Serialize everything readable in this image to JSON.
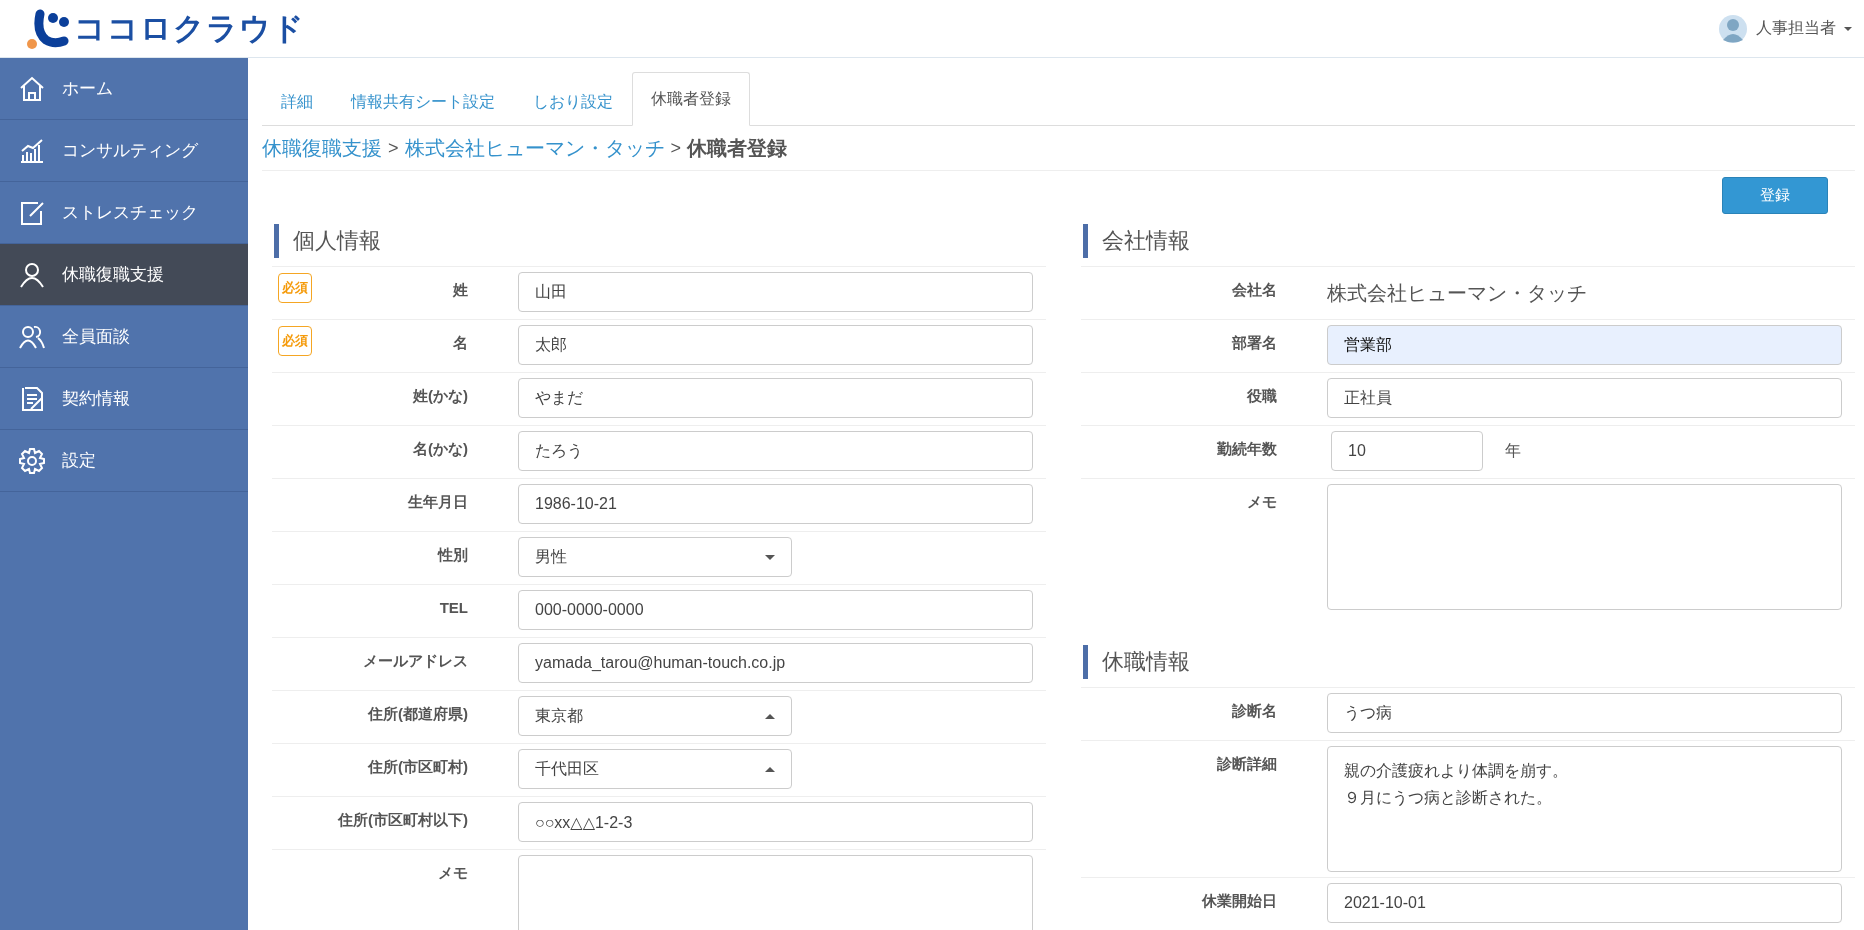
{
  "header": {
    "logo_text": "ココロクラウド",
    "user": {
      "name": "人事担当者"
    }
  },
  "sidebar": {
    "items": [
      {
        "label": "ホーム",
        "selected": false
      },
      {
        "label": "コンサルティング",
        "selected": false
      },
      {
        "label": "ストレスチェック",
        "selected": false
      },
      {
        "label": "休職復職支援",
        "selected": true
      },
      {
        "label": "全員面談",
        "selected": false
      },
      {
        "label": "契約情報",
        "selected": false
      },
      {
        "label": "設定",
        "selected": false
      }
    ]
  },
  "tabs": [
    {
      "label": "詳細",
      "selected": false
    },
    {
      "label": "情報共有シート設定",
      "selected": false
    },
    {
      "label": "しおり設定",
      "selected": false
    },
    {
      "label": "休職者登録",
      "selected": true
    }
  ],
  "breadcrumb": [
    {
      "kind": "link",
      "text": "休職復職支援"
    },
    {
      "kind": "separator",
      "text": ">"
    },
    {
      "kind": "link",
      "text": "株式会社ヒューマン・タッチ"
    },
    {
      "kind": "separator",
      "text": ">"
    },
    {
      "kind": "current",
      "text": "休職者登録"
    }
  ],
  "register_button": "登録",
  "personal": {
    "title": "個人情報",
    "rows": [
      {
        "label": "姓",
        "required": true,
        "required_badge": "必須",
        "kind": "text",
        "value": "山田"
      },
      {
        "label": "名",
        "required": true,
        "required_badge": "必須",
        "kind": "text",
        "value": "太郎"
      },
      {
        "label": "姓(かな)",
        "required": false,
        "kind": "text",
        "value": "やまだ"
      },
      {
        "label": "名(かな)",
        "required": false,
        "kind": "text",
        "value": "たろう"
      },
      {
        "label": "生年月日",
        "required": false,
        "kind": "text",
        "value": "1986-10-21"
      },
      {
        "label": "性別",
        "required": false,
        "kind": "select",
        "value": "男性",
        "expanded": false
      },
      {
        "label": "TEL",
        "required": false,
        "kind": "text",
        "value": "000-0000-0000"
      },
      {
        "label": "メールアドレス",
        "required": false,
        "kind": "text",
        "value": "yamada_tarou@human-touch.co.jp"
      },
      {
        "label": "住所(都道府県)",
        "required": false,
        "kind": "select",
        "value": "東京都",
        "expanded": true
      },
      {
        "label": "住所(市区町村)",
        "required": false,
        "kind": "select",
        "value": "千代田区",
        "expanded": true
      },
      {
        "label": "住所(市区町村以下)",
        "required": false,
        "kind": "text",
        "value": "○○xx△△1-2-3"
      },
      {
        "label": "メモ",
        "required": false,
        "kind": "textarea"
      }
    ]
  },
  "company": {
    "title": "会社情報",
    "rows": [
      {
        "label": "会社名",
        "kind": "static",
        "value": "株式会社ヒューマン・タッチ"
      },
      {
        "label": "部署名",
        "kind": "text",
        "value": "営業部",
        "autofilled": true
      },
      {
        "label": "役職",
        "kind": "text",
        "value": "正社員",
        "autofilled": false
      },
      {
        "label": "勤続年数",
        "kind": "number",
        "value": "10",
        "unit": "年"
      },
      {
        "label": "メモ",
        "kind": "textarea"
      }
    ]
  },
  "leave": {
    "title": "休職情報",
    "rows": [
      {
        "label": "診断名",
        "kind": "text",
        "value": "うつ病",
        "autofilled": false
      },
      {
        "label": "診断詳細",
        "kind": "textarea",
        "lines": [
          "親の介護疲れより体調を崩す。",
          "９月にうつ病と診断された。"
        ]
      },
      {
        "label": "休業開始日",
        "kind": "text",
        "value": "2021-10-01",
        "autofilled": false
      }
    ]
  }
}
